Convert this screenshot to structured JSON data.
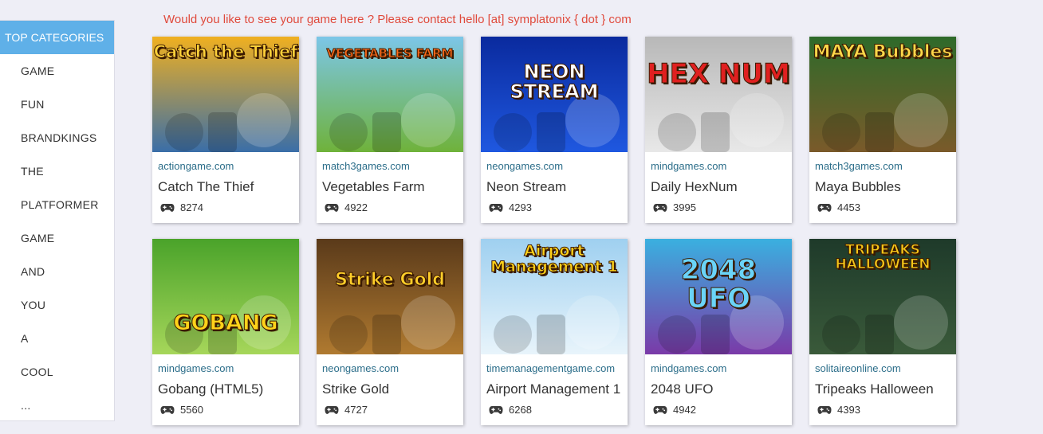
{
  "notice": "Would you like to see your game here ? Please contact hello [at] symplatonix { dot } com",
  "sidebar": {
    "header": "TOP CATEGORIES",
    "items": [
      "GAME",
      "FUN",
      "BRANDKINGS",
      "THE",
      "PLATFORMER",
      "GAME",
      "AND",
      "YOU",
      "A",
      "COOL",
      "..."
    ]
  },
  "games": [
    {
      "site": "actiongame.com",
      "name": "Catch The Thief",
      "plays": "8274",
      "thumb_text": "Catch the Thief",
      "colors": [
        "#f0b020",
        "#3a6ea8"
      ]
    },
    {
      "site": "match3games.com",
      "name": "Vegetables Farm",
      "plays": "4922",
      "thumb_text": "VEGETABLES FARM",
      "colors": [
        "#7cc6e8",
        "#6fb23a"
      ]
    },
    {
      "site": "neongames.com",
      "name": "Neon Stream",
      "plays": "4293",
      "thumb_text": "NEON STREAM",
      "colors": [
        "#0a2a9e",
        "#1f58e0"
      ]
    },
    {
      "site": "mindgames.com",
      "name": "Daily HexNum",
      "plays": "3995",
      "thumb_text": "HEX NUM",
      "colors": [
        "#b8b8b8",
        "#e8e8e8"
      ]
    },
    {
      "site": "match3games.com",
      "name": "Maya Bubbles",
      "plays": "4453",
      "thumb_text": "MAYA Bubbles",
      "colors": [
        "#2e6a2a",
        "#7a5a2a"
      ]
    },
    {
      "site": "mindgames.com",
      "name": "Gobang (HTML5)",
      "plays": "5560",
      "thumb_text": "GOBANG",
      "colors": [
        "#4aa32a",
        "#a6d65a"
      ]
    },
    {
      "site": "neongames.com",
      "name": "Strike Gold",
      "plays": "4727",
      "thumb_text": "Strike Gold",
      "colors": [
        "#5a3a1a",
        "#b07a30"
      ]
    },
    {
      "site": "timemanagementgame.com",
      "name": "Airport Management 1",
      "plays": "6268",
      "thumb_text": "Airport Management 1",
      "colors": [
        "#9fd0f0",
        "#e8f4fb"
      ]
    },
    {
      "site": "mindgames.com",
      "name": "2048 UFO",
      "plays": "4942",
      "thumb_text": "2048 UFO",
      "colors": [
        "#3ab0e0",
        "#7a3aa8"
      ]
    },
    {
      "site": "solitaireonline.com",
      "name": "Tripeaks Halloween",
      "plays": "4393",
      "thumb_text": "TRIPEAKS HALLOWEEN",
      "colors": [
        "#1e3a2a",
        "#3a5a3a"
      ]
    }
  ]
}
